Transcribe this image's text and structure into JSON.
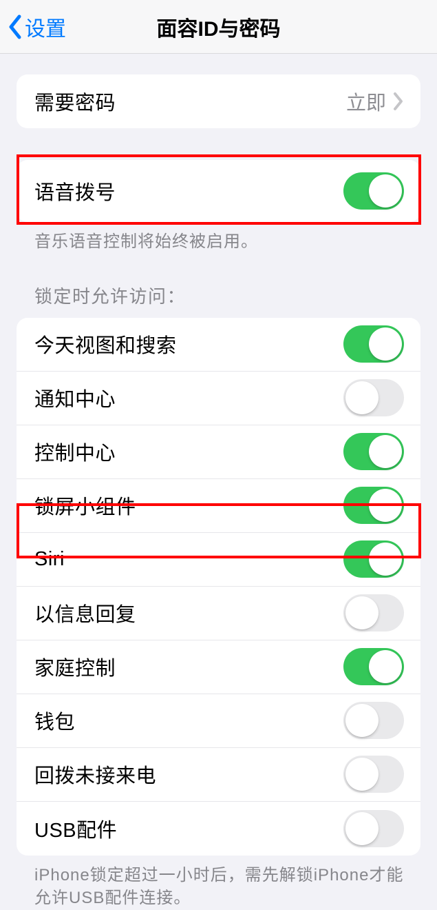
{
  "nav": {
    "back_label": "设置",
    "title": "面容ID与密码"
  },
  "passcode_group": {
    "require_label": "需要密码",
    "require_value": "立即"
  },
  "voice_group": {
    "voice_dial_label": "语音拨号",
    "voice_dial_on": true,
    "footer": "音乐语音控制将始终被启用。"
  },
  "lock_section_header": "锁定时允许访问：",
  "lock_items": [
    {
      "label": "今天视图和搜索",
      "on": true
    },
    {
      "label": "通知中心",
      "on": false
    },
    {
      "label": "控制中心",
      "on": true
    },
    {
      "label": "锁屏小组件",
      "on": true
    },
    {
      "label": "Siri",
      "on": true
    },
    {
      "label": "以信息回复",
      "on": false
    },
    {
      "label": "家庭控制",
      "on": true
    },
    {
      "label": "钱包",
      "on": false
    },
    {
      "label": "回拨未接来电",
      "on": false
    },
    {
      "label": "USB配件",
      "on": false
    }
  ],
  "bottom_note": "iPhone锁定超过一小时后，需先解锁iPhone才能允许USB配件连接。"
}
